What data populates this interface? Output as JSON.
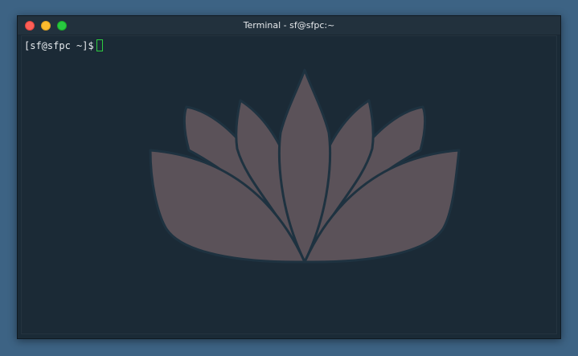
{
  "window": {
    "title": "Terminal - sf@sfpc:~"
  },
  "terminal": {
    "prompt": "[sf@sfpc ~]$"
  },
  "colors": {
    "desktop": "#3d6384",
    "terminal_bg": "#1b2a36",
    "petal": "#5b5259",
    "petal_outline": "#1e3240",
    "cursor": "#2ecc40"
  },
  "icons": {
    "wallpaper": "lotus-icon",
    "close": "close-dot",
    "minimize": "minimize-dot",
    "maximize": "maximize-dot"
  }
}
